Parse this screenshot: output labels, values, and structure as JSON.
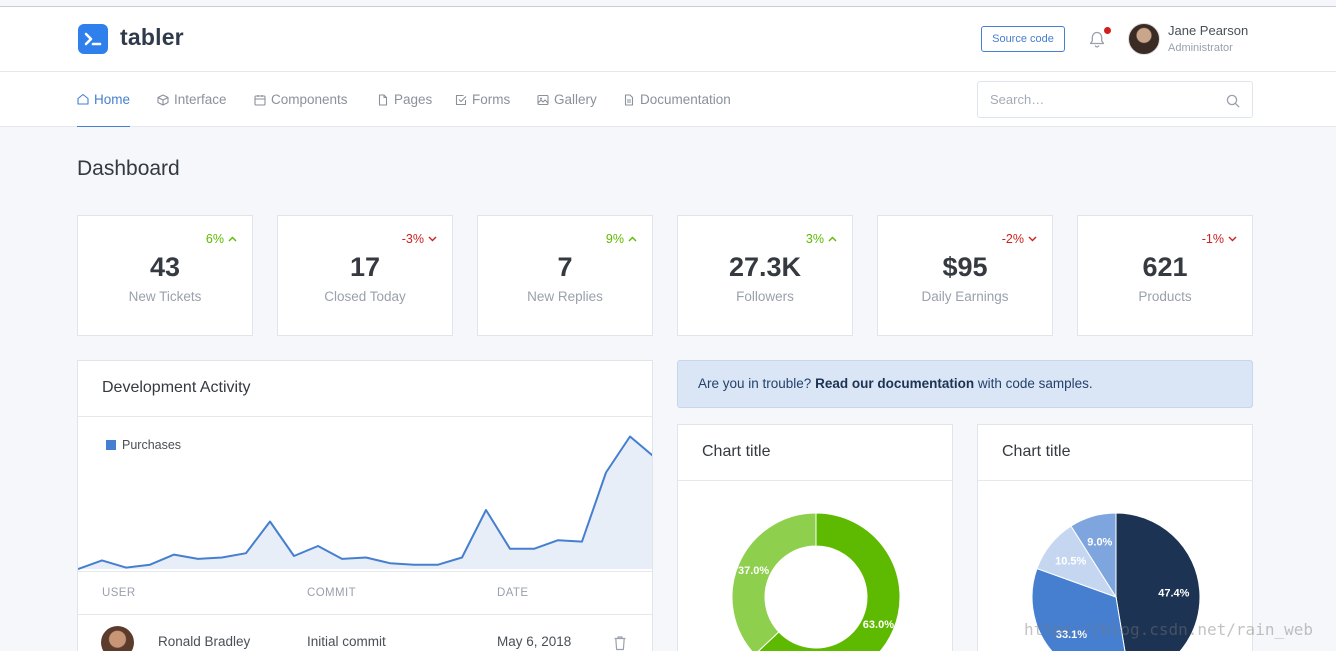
{
  "brand": {
    "name": "tabler",
    "accent": "#467fcf",
    "logo_color": "#2f80ed"
  },
  "header": {
    "source_button": "Source code",
    "notification_icon": "bell-icon",
    "user": {
      "name": "Jane Pearson",
      "role": "Administrator"
    }
  },
  "nav": {
    "items": [
      {
        "label": "Home",
        "icon": "home-icon",
        "active": true
      },
      {
        "label": "Interface",
        "icon": "box-icon"
      },
      {
        "label": "Components",
        "icon": "calendar-icon"
      },
      {
        "label": "Pages",
        "icon": "file-icon"
      },
      {
        "label": "Forms",
        "icon": "check-square-icon"
      },
      {
        "label": "Gallery",
        "icon": "image-icon"
      },
      {
        "label": "Documentation",
        "icon": "file-text-icon"
      }
    ],
    "search_placeholder": "Search…"
  },
  "page": {
    "title": "Dashboard"
  },
  "stats": [
    {
      "change": "6%",
      "direction": "up",
      "value": "43",
      "label": "New Tickets"
    },
    {
      "change": "-3%",
      "direction": "down",
      "value": "17",
      "label": "Closed Today"
    },
    {
      "change": "9%",
      "direction": "up",
      "value": "7",
      "label": "New Replies"
    },
    {
      "change": "3%",
      "direction": "up",
      "value": "27.3K",
      "label": "Followers"
    },
    {
      "change": "-2%",
      "direction": "down",
      "value": "$95",
      "label": "Daily Earnings"
    },
    {
      "change": "-1%",
      "direction": "down",
      "value": "621",
      "label": "Products"
    }
  ],
  "activity": {
    "title": "Development Activity",
    "legend": "Purchases",
    "columns": [
      "USER",
      "COMMIT",
      "DATE"
    ],
    "rows": [
      {
        "user": "Ronald Bradley",
        "commit": "Initial commit",
        "date": "May 6, 2018"
      }
    ]
  },
  "alert": {
    "prefix": "Are you in trouble?",
    "link": "Read our documentation",
    "suffix": "with code samples."
  },
  "chart_data": [
    {
      "type": "area",
      "series": [
        {
          "name": "Purchases",
          "values": [
            0,
            6,
            1,
            3,
            10,
            7,
            8,
            11,
            33,
            9,
            16,
            7,
            8,
            4,
            3,
            3,
            8,
            41,
            14,
            14,
            20,
            19,
            67,
            92,
            78
          ]
        }
      ],
      "ylim": [
        0,
        100
      ],
      "legend": "top-left",
      "color": "#467fcf"
    },
    {
      "type": "pie",
      "title": "Chart title",
      "donut": true,
      "slices": [
        {
          "label": "63.0%",
          "value": 63.0,
          "color": "#5eba00"
        },
        {
          "label": "37.0%",
          "value": 37.0,
          "color": "#8ecf4d"
        }
      ]
    },
    {
      "type": "pie",
      "title": "Chart title",
      "donut": false,
      "slices": [
        {
          "label": "47.4%",
          "value": 47.4,
          "color": "#1c3353"
        },
        {
          "label": "33.1%",
          "value": 33.1,
          "color": "#467fcf"
        },
        {
          "label": "10.5%",
          "value": 10.5,
          "color": "#c5d6f0"
        },
        {
          "label": "9.0%",
          "value": 9.0,
          "color": "#7ea5dd"
        }
      ]
    }
  ],
  "watermark": "https://blog.csdn.net/rain_web"
}
